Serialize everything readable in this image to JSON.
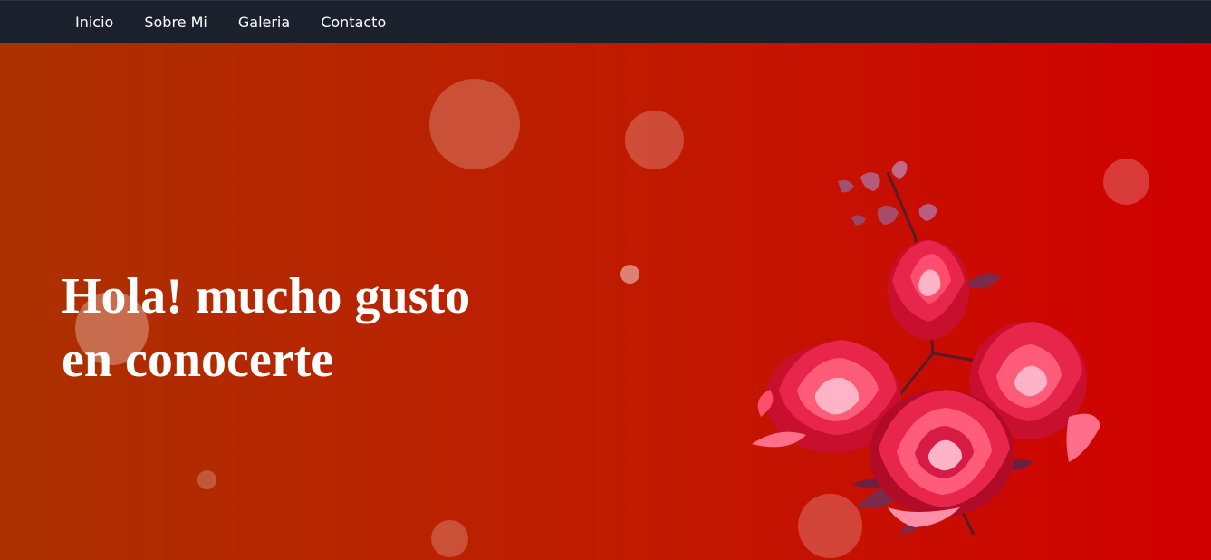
{
  "nav": {
    "items": [
      {
        "label": "Inicio"
      },
      {
        "label": "Sobre Mi"
      },
      {
        "label": "Galeria"
      },
      {
        "label": "Contacto"
      }
    ]
  },
  "hero": {
    "title_line1": "Hola! mucho gusto",
    "title_line2": "en conocerte"
  },
  "image": {
    "icon": "roses-bouquet-illustration"
  },
  "colors": {
    "navbar": "#1a202c",
    "hero_gradient_start": "#ac3100",
    "hero_gradient_end": "#d10000",
    "text": "#ffffff"
  }
}
